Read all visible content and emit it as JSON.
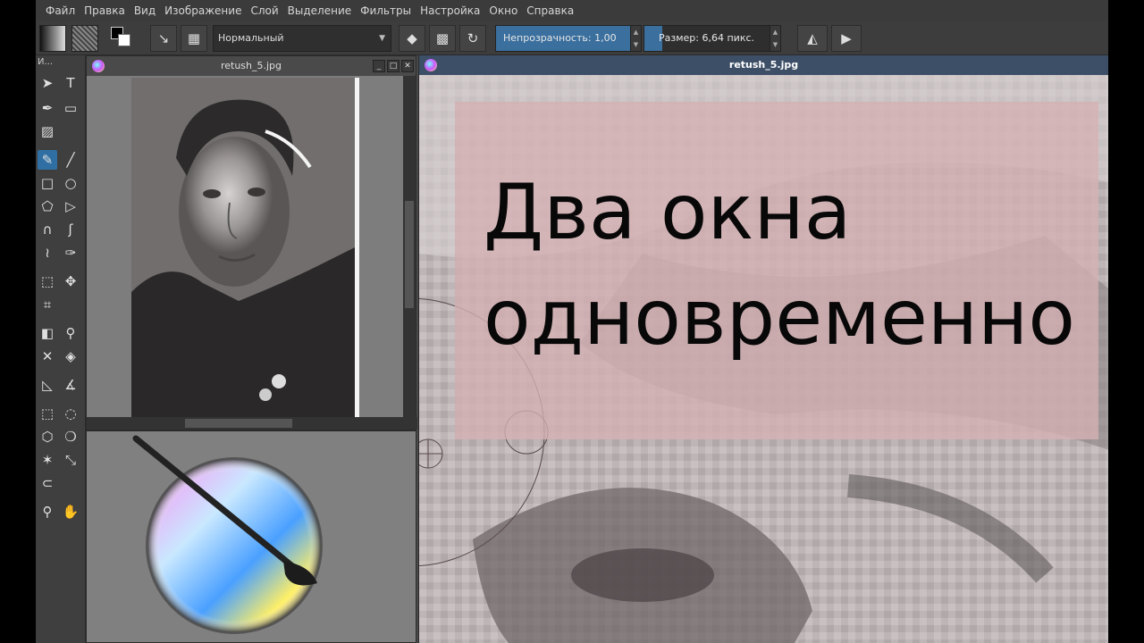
{
  "menu": [
    "Файл",
    "Правка",
    "Вид",
    "Изображение",
    "Слой",
    "Выделение",
    "Фильтры",
    "Настройка",
    "Окно",
    "Справка"
  ],
  "toolbar": {
    "blend_mode": "Нормальный",
    "opacity_label": "Непрозрачность:",
    "opacity_value": "1,00",
    "opacity_fill": 1.0,
    "size_label": "Размер:",
    "size_value": "6,64 пикс.",
    "size_fill": 0.13
  },
  "toolbox": {
    "title": "И..."
  },
  "left_window": {
    "title": "retush_5.jpg"
  },
  "main_window": {
    "title": "retush_5.jpg"
  },
  "overlay": {
    "text": "Два окна\nодновременно"
  },
  "colors": {
    "accent": "#2f6fa3",
    "title_active": "#3d4f67",
    "overlay": "#d5afb2"
  },
  "icons": [
    "pointer-icon",
    "text-icon",
    "pen-icon",
    "gradient-icon",
    "brush-icon",
    "line-icon",
    "rect-icon",
    "ellipse-icon",
    "polygon-icon",
    "polyline-icon",
    "bezier-icon",
    "freehand-path-icon",
    "dynamic-brush-icon",
    "multibrush-icon",
    "transform-icon",
    "move-icon",
    "crop-icon",
    "gradient-fill-icon",
    "eyedropper-icon",
    "smart-patch-icon",
    "fill-icon",
    "assistant-icon",
    "measure-icon",
    "rect-select-icon",
    "ellipse-select-icon",
    "freehand-select-icon",
    "similar-select-icon",
    "magic-wand-icon",
    "bezier-select-icon",
    "magnetic-select-icon",
    "zoom-icon",
    "pan-icon"
  ]
}
